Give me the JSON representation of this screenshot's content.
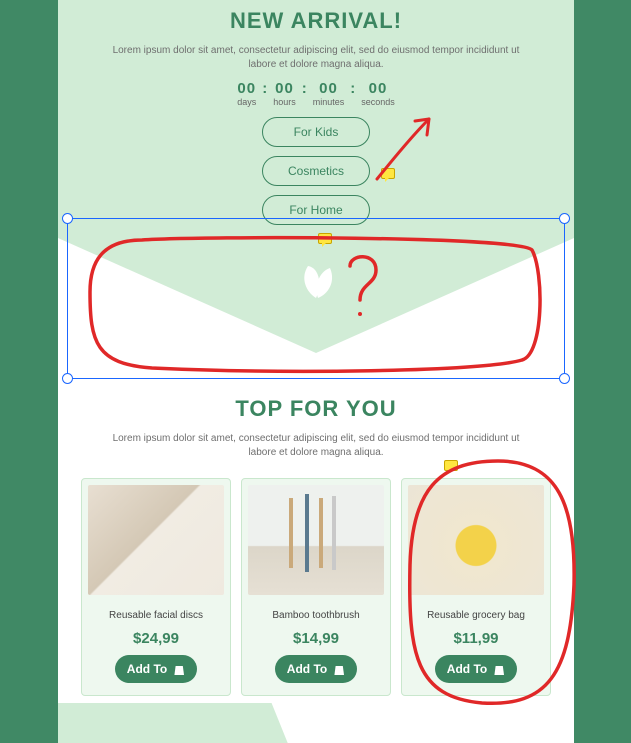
{
  "header": {
    "title": "NEW ARRIVAL!",
    "desc": "Lorem ipsum dolor sit amet, consectetur adipiscing elit, sed do eiusmod tempor incididunt ut labore et dolore magna aliqua."
  },
  "timer": {
    "days": {
      "value": "00",
      "label": "days"
    },
    "hours": {
      "value": "00",
      "label": "hours"
    },
    "minutes": {
      "value": "00",
      "label": "minutes"
    },
    "seconds": {
      "value": "00",
      "label": "seconds"
    }
  },
  "categories": {
    "kids": "For Kids",
    "cosmetics": "Cosmetics",
    "home": "For Home"
  },
  "section2": {
    "title": "TOP FOR YOU",
    "desc": "Lorem ipsum dolor sit amet, consectetur adipiscing elit, sed do eiusmod tempor incididunt ut labore et dolore magna aliqua."
  },
  "products": [
    {
      "name": "Reusable facial discs",
      "price": "$24,99",
      "button": "Add To"
    },
    {
      "name": "Bamboo toothbrush",
      "price": "$14,99",
      "button": "Add To"
    },
    {
      "name": "Reusable grocery bag",
      "price": "$11,99",
      "button": "Add To"
    }
  ],
  "annotations": {
    "question_mark": "?"
  }
}
